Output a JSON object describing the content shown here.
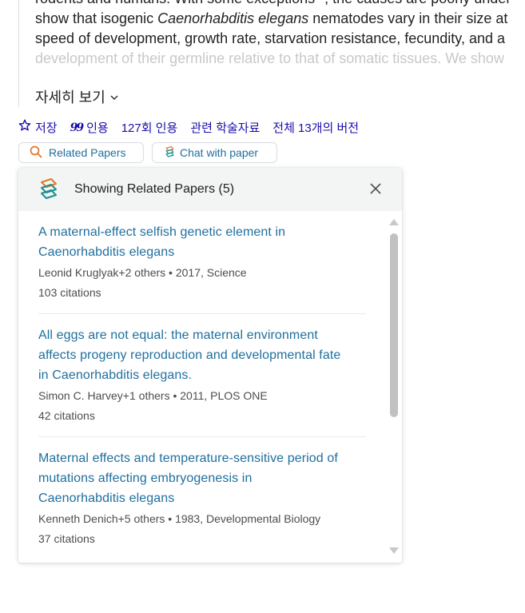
{
  "abstract": {
    "lines": [
      "rodents and humans. With some exceptions¹¹, the causes are poorly under",
      "show that isogenic ",
      "speed of development, growth rate, starvation resistance, fecundity, and a",
      "development of their germline relative to that of somatic tissues. We show"
    ],
    "species": "Caenorhabditis elegans",
    "line2_tail": " nematodes vary in their size at",
    "more_label": "자세히 보기"
  },
  "actions": {
    "save": "저장",
    "cite": "인용",
    "cited_by": "127회 인용",
    "related": "관련 학술자료",
    "versions": "전체 13개의 버전"
  },
  "buttons": {
    "related_papers": "Related Papers",
    "chat_with_paper": "Chat with paper"
  },
  "panel": {
    "title": "Showing Related Papers (5)",
    "papers": [
      {
        "title_lines": [
          "A maternal-effect selfish genetic element in",
          "Caenorhabditis elegans"
        ],
        "meta": "Leonid Kruglyak+2 others • 2017, Science",
        "citations": "103 citations"
      },
      {
        "title_lines": [
          "All eggs are not equal: the maternal environment",
          "affects progeny reproduction and developmental fate",
          "in Caenorhabditis elegans."
        ],
        "meta": "Simon C. Harvey+1 others • 2011, PLOS ONE",
        "citations": "42 citations"
      },
      {
        "title_lines": [
          "Maternal effects and temperature-sensitive period of",
          "mutations affecting embryogenesis in",
          "Caenorhabditis elegans"
        ],
        "meta": "Kenneth Denich+5 others • 1983, Developmental Biology",
        "citations": "37 citations"
      }
    ]
  },
  "colors": {
    "link": "#1a0dab",
    "paper_title": "#1f6f9e",
    "panel_header": "#f3f4f4"
  }
}
